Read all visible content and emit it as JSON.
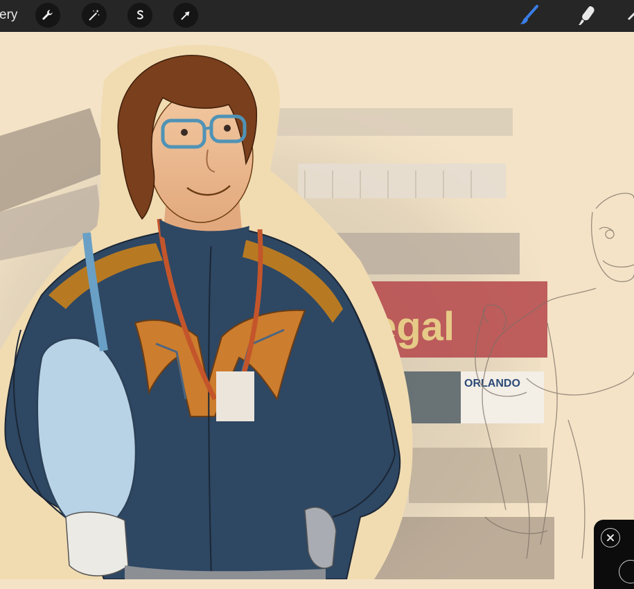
{
  "toolbar": {
    "gallery_label": "ery",
    "left_tools": [
      {
        "icon": "wrench-icon",
        "name": "actions"
      },
      {
        "icon": "magic-wand-icon",
        "name": "adjustments"
      },
      {
        "icon": "selection-s-icon",
        "name": "selection"
      },
      {
        "icon": "arrow-cursor-icon",
        "name": "transform"
      }
    ],
    "right_tools": [
      {
        "icon": "brush-icon",
        "name": "paint",
        "active": true
      },
      {
        "icon": "smudge-icon",
        "name": "smudge",
        "active": false
      }
    ],
    "active_color": "#3a7ee8"
  },
  "canvas": {
    "sign_text": "ORLANDO",
    "banner_text": "egal",
    "artwork": "Digital illustration of a character in a navy superhero suit with orange emblem and lanyard badge, over a convention hall photo background, with a pencil sketch on the right"
  },
  "floating_panel": {
    "close_icon": "close-icon"
  }
}
